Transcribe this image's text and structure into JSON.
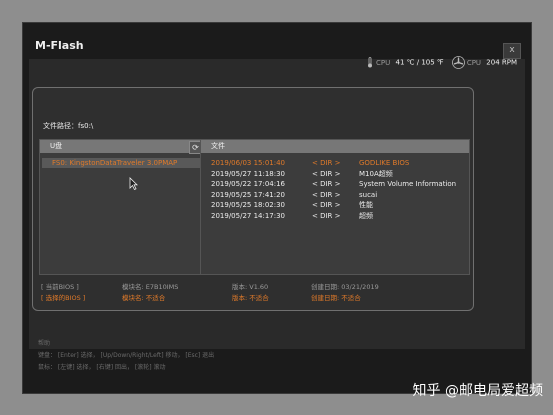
{
  "window": {
    "title": "M-Flash",
    "close": "x"
  },
  "status": {
    "cpu_temp_label": "CPU",
    "cpu_temp_value": "41 ℃ / 105 ℉",
    "cpu_fan_label": "CPU",
    "cpu_fan_value": "204 RPM"
  },
  "dialog": {
    "path": "文件路径：fs0:\\",
    "left_header": "U盘",
    "right_header": "文件",
    "refresh_icon": "⟳",
    "device": "FS0: KingstonDataTraveler 3.0PMAP",
    "files": [
      {
        "date": "2019/06/03 15:01:40",
        "type": "< DIR >",
        "name": "GODLIKE BIOS",
        "selected": true
      },
      {
        "date": "2019/05/27 11:18:30",
        "type": "< DIR >",
        "name": "M10A超频"
      },
      {
        "date": "2019/05/22 17:04:16",
        "type": "< DIR >",
        "name": "System Volume Information"
      },
      {
        "date": "2019/05/25 17:41:20",
        "type": "< DIR >",
        "name": "sucai"
      },
      {
        "date": "2019/05/25 18:02:30",
        "type": "< DIR >",
        "name": "性能"
      },
      {
        "date": "2019/05/27 14:17:30",
        "type": "< DIR >",
        "name": "超频"
      }
    ],
    "current_bios": {
      "label": "[    当前BIOS    ]",
      "module": "模块名: E7B10IMS",
      "version": "版本: V1.60",
      "date": "创建日期: 03/21/2019"
    },
    "selected_bios": {
      "label": "[  选择的BIOS   ]",
      "module": "模块名: 不适合",
      "version": "版本: 不适合",
      "date": "创建日期: 不适合"
    }
  },
  "help": {
    "title": "帮助",
    "keyboard": "键盘：  [Enter] 选择，  [Up/Down/Right/Left]  移动，  [Esc]  退出",
    "mouse": "鼠标：  [左键] 选择，  [右键]  回出，  [滚轮]  滚动"
  },
  "watermark": "知乎 @邮电局爱超频"
}
